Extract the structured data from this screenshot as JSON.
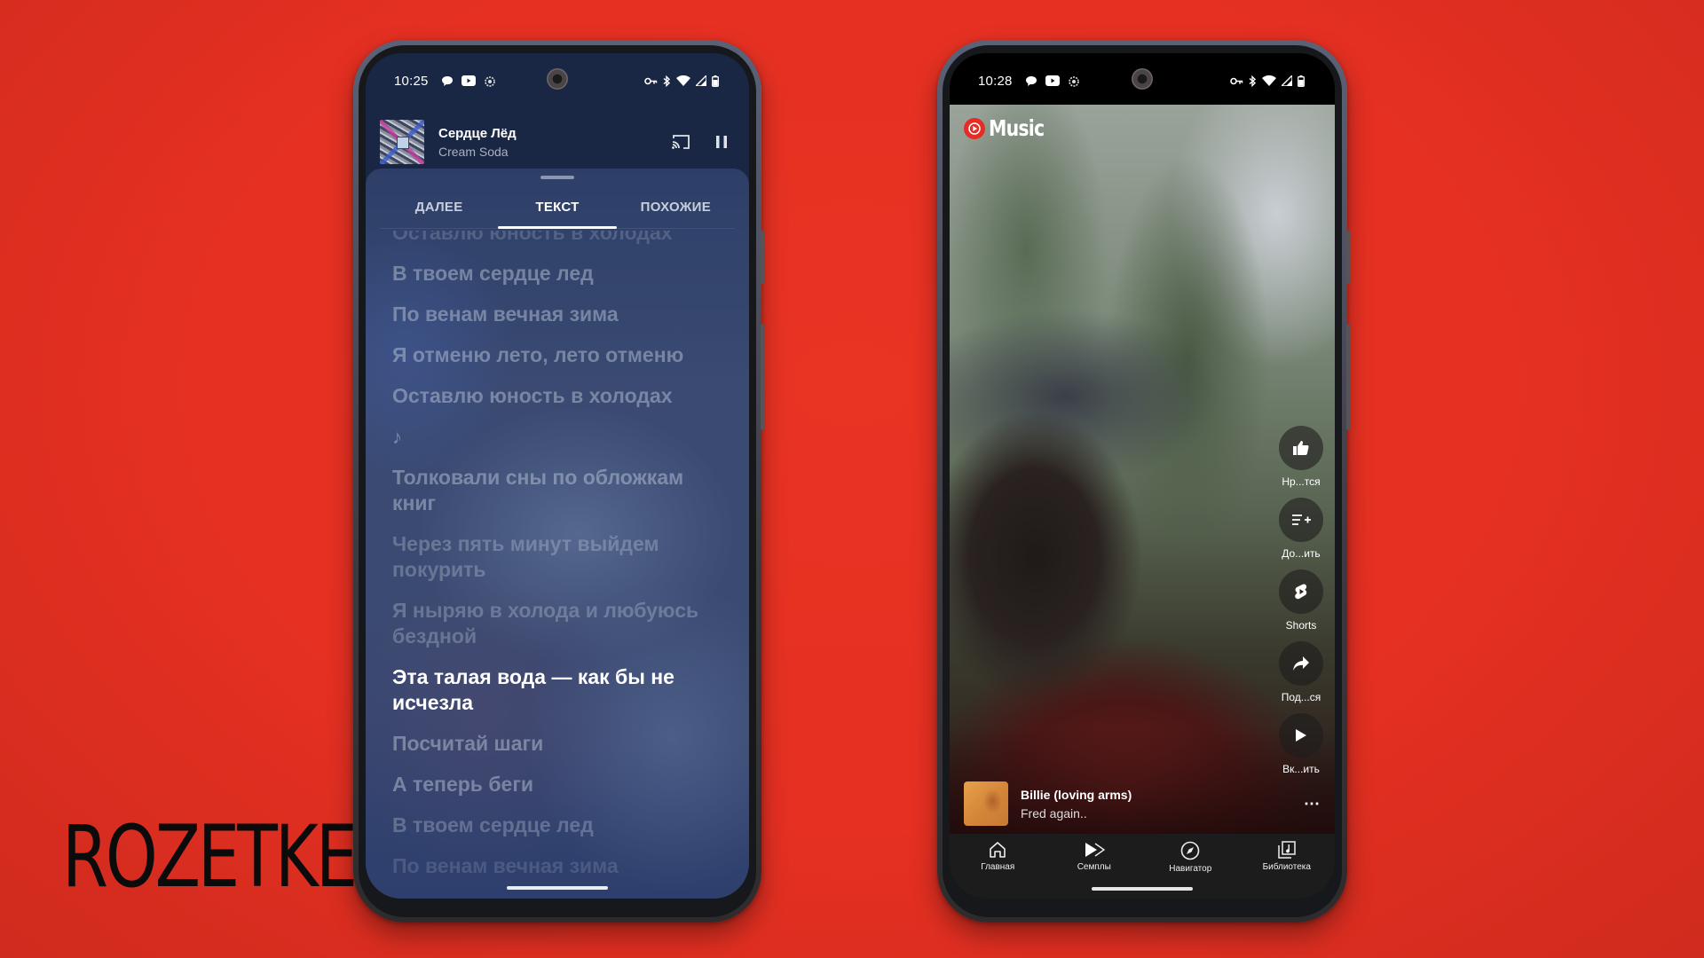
{
  "brand": {
    "logo_text": "ROZETKED"
  },
  "colors": {
    "background": "#e53022",
    "left_screen_bg": "#1a2744",
    "lyrics_sheet_bg": "#3a4a72",
    "youtube_red": "#e52d27",
    "nav_bg": "#1c1c1c"
  },
  "left_phone": {
    "status_bar": {
      "time": "10:25",
      "left_icons": [
        "chat-bubble-icon",
        "youtube-icon",
        "app-icon"
      ],
      "right_icons": [
        "vpn-key-icon",
        "bluetooth-icon",
        "wifi-icon",
        "signal-icon",
        "battery-icon"
      ]
    },
    "mini_player": {
      "title": "Сердце Лёд",
      "artist": "Cream Soda",
      "controls": [
        "cast-icon",
        "pause-icon"
      ]
    },
    "tabs": [
      {
        "label": "ДАЛЕЕ",
        "active": false
      },
      {
        "label": "ТЕКСТ",
        "active": true
      },
      {
        "label": "ПОХОЖИЕ",
        "active": false
      }
    ],
    "lyrics": [
      {
        "text": "Оставлю юность в холодах",
        "state": "faded-top"
      },
      {
        "text": "В твоем сердце лед",
        "state": "past"
      },
      {
        "text": "По венам вечная зима",
        "state": "past"
      },
      {
        "text": "Я отменю лето, лето отменю",
        "state": "past"
      },
      {
        "text": "Оставлю юность в холодах",
        "state": "past"
      },
      {
        "text": "♪",
        "state": "note"
      },
      {
        "text": "Толковали сны по обложкам книг",
        "state": "past"
      },
      {
        "text": "Через пять минут выйдем покурить",
        "state": "dim"
      },
      {
        "text": "Я ныряю в холода и любуюсь бездной",
        "state": "dim"
      },
      {
        "text": "Эта талая вода — как бы не исчезла",
        "state": "active"
      },
      {
        "text": "Посчитай шаги",
        "state": "upcoming"
      },
      {
        "text": "А теперь беги",
        "state": "upcoming"
      },
      {
        "text": "В твоем сердце лед",
        "state": "dim"
      },
      {
        "text": "По венам вечная зима",
        "state": "faded-bottom"
      }
    ]
  },
  "right_phone": {
    "status_bar": {
      "time": "10:28",
      "left_icons": [
        "chat-bubble-icon",
        "youtube-icon",
        "app-icon"
      ],
      "right_icons": [
        "vpn-key-icon",
        "bluetooth-icon",
        "wifi-icon",
        "signal-icon",
        "battery-icon"
      ]
    },
    "app_logo": "Music",
    "actions": [
      {
        "icon": "thumbs-up-icon",
        "label": "Нр...тся"
      },
      {
        "icon": "add-to-playlist-icon",
        "label": "До...ить"
      },
      {
        "icon": "shorts-icon",
        "label": "Shorts"
      },
      {
        "icon": "share-icon",
        "label": "Под...ся"
      },
      {
        "icon": "play-icon",
        "label": "Вк...ить"
      }
    ],
    "now_playing": {
      "title": "Billie (loving arms)",
      "artist": "Fred again..",
      "more": "⋯"
    },
    "bottom_nav": [
      {
        "icon": "home-icon",
        "label": "Главная"
      },
      {
        "icon": "samples-icon",
        "label": "Семплы"
      },
      {
        "icon": "compass-icon",
        "label": "Навигатор"
      },
      {
        "icon": "library-icon",
        "label": "Библиотека"
      }
    ]
  }
}
